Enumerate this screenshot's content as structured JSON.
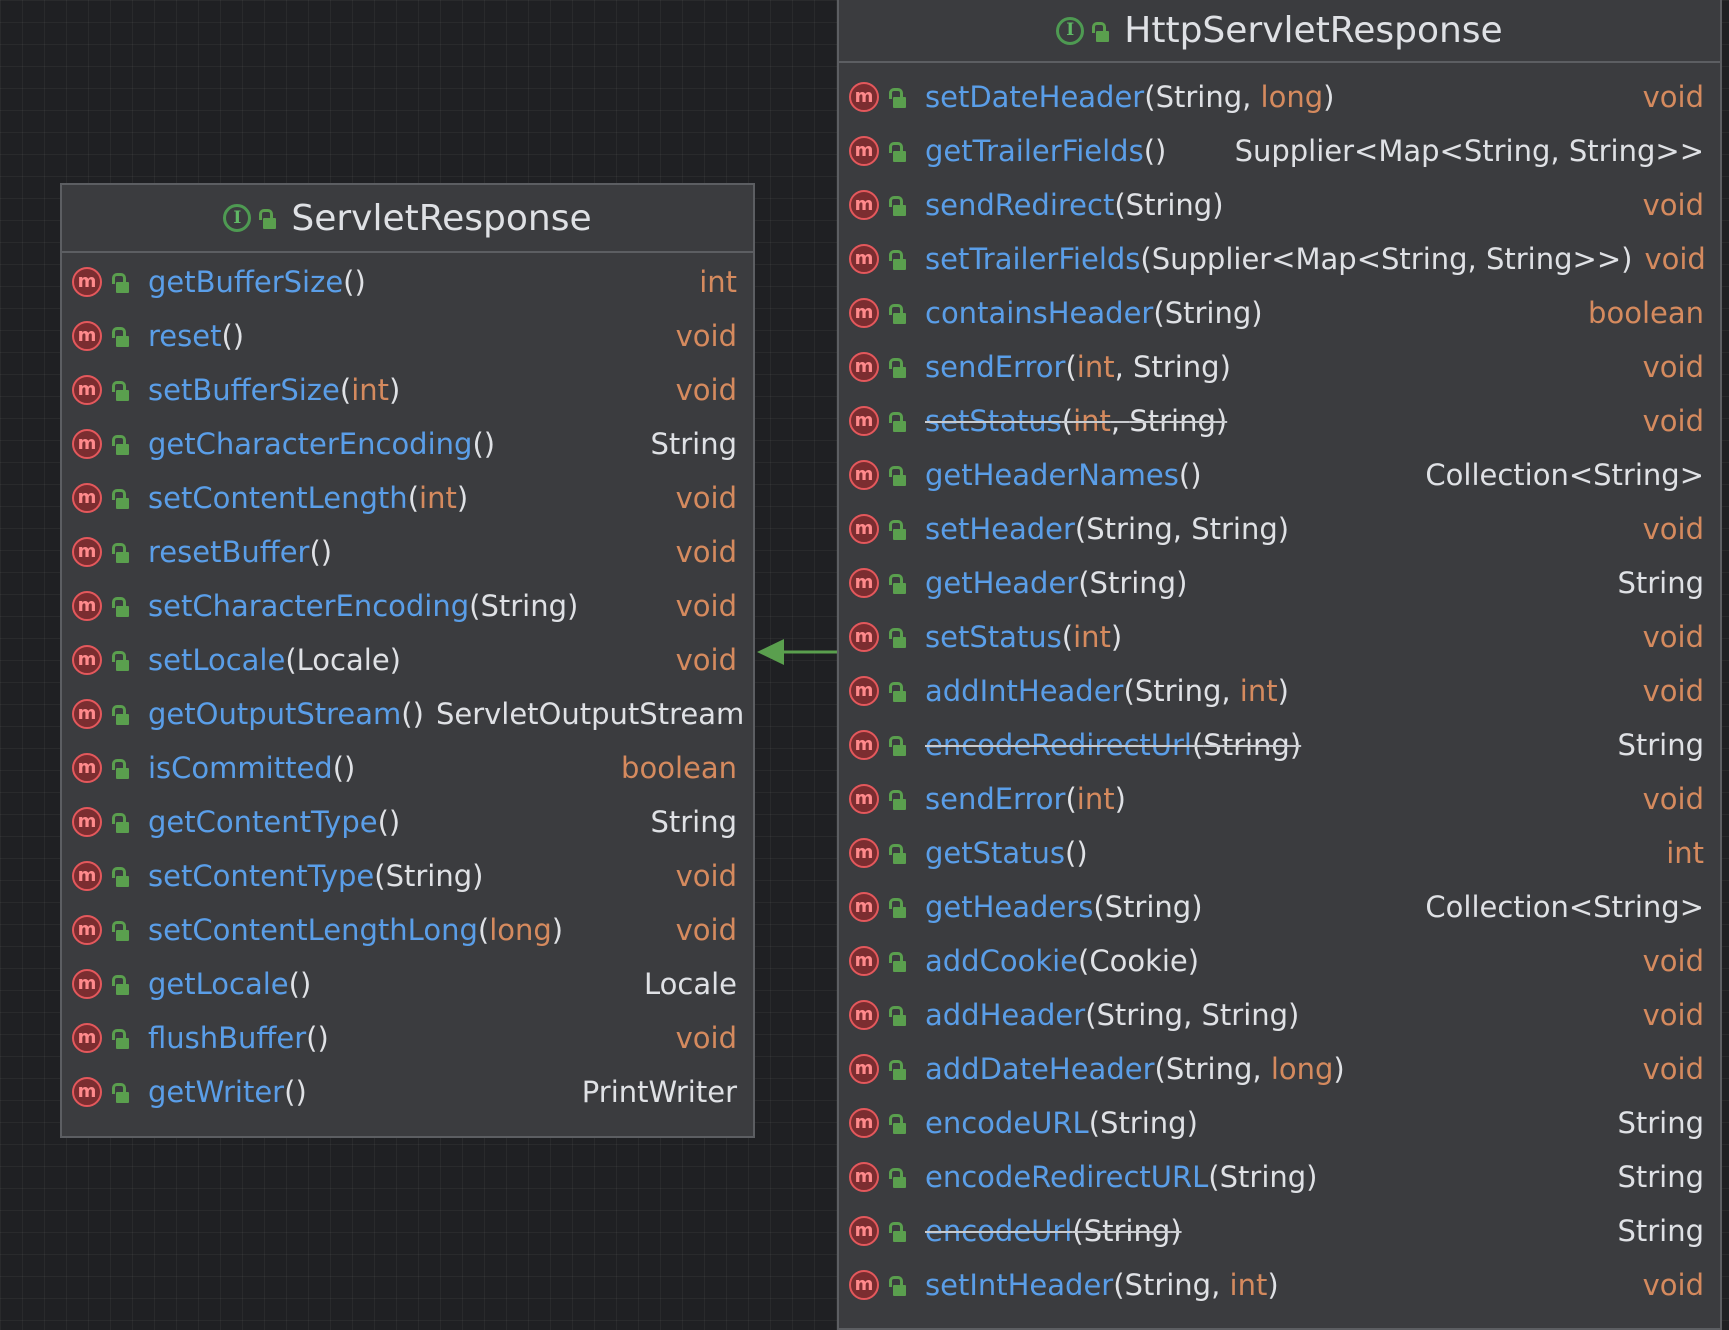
{
  "servlet_response": {
    "name": "ServletResponse",
    "methods": [
      {
        "name": "getBufferSize",
        "open": "(",
        "params": [],
        "close": ")",
        "ret": "int",
        "ret_primitive": true
      },
      {
        "name": "reset",
        "open": "(",
        "params": [],
        "close": ")",
        "ret": "void",
        "ret_primitive": true
      },
      {
        "name": "setBufferSize",
        "open": "(",
        "params": [
          {
            "t": "int",
            "p": true
          }
        ],
        "close": ")",
        "ret": "void",
        "ret_primitive": true
      },
      {
        "name": "getCharacterEncoding",
        "open": "(",
        "params": [],
        "close": ")",
        "ret": "String",
        "ret_primitive": false
      },
      {
        "name": "setContentLength",
        "open": "(",
        "params": [
          {
            "t": "int",
            "p": true
          }
        ],
        "close": ")",
        "ret": "void",
        "ret_primitive": true
      },
      {
        "name": "resetBuffer",
        "open": "(",
        "params": [],
        "close": ")",
        "ret": "void",
        "ret_primitive": true
      },
      {
        "name": "setCharacterEncoding",
        "open": "(",
        "params": [
          {
            "t": "String",
            "p": false
          }
        ],
        "close": ")",
        "ret": "void",
        "ret_primitive": true
      },
      {
        "name": "setLocale",
        "open": "(",
        "params": [
          {
            "t": "Locale",
            "p": false
          }
        ],
        "close": ")",
        "ret": "void",
        "ret_primitive": true
      },
      {
        "name": "getOutputStream",
        "open": "(",
        "params": [],
        "close": ")",
        "ret": "ServletOutputStream",
        "ret_primitive": false
      },
      {
        "name": "isCommitted",
        "open": "(",
        "params": [],
        "close": ")",
        "ret": "boolean",
        "ret_primitive": true
      },
      {
        "name": "getContentType",
        "open": "(",
        "params": [],
        "close": ")",
        "ret": "String",
        "ret_primitive": false
      },
      {
        "name": "setContentType",
        "open": "(",
        "params": [
          {
            "t": "String",
            "p": false
          }
        ],
        "close": ")",
        "ret": "void",
        "ret_primitive": true
      },
      {
        "name": "setContentLengthLong",
        "open": "(",
        "params": [
          {
            "t": "long",
            "p": true
          }
        ],
        "close": ")",
        "ret": "void",
        "ret_primitive": true
      },
      {
        "name": "getLocale",
        "open": "(",
        "params": [],
        "close": ")",
        "ret": "Locale",
        "ret_primitive": false
      },
      {
        "name": "flushBuffer",
        "open": "(",
        "params": [],
        "close": ")",
        "ret": "void",
        "ret_primitive": true
      },
      {
        "name": "getWriter",
        "open": "(",
        "params": [],
        "close": ")",
        "ret": "PrintWriter",
        "ret_primitive": false
      }
    ]
  },
  "http_servlet_response": {
    "name": "HttpServletResponse",
    "methods": [
      {
        "name": "setDateHeader",
        "open": "(",
        "params": [
          {
            "t": "String",
            "p": false
          },
          {
            "t": "long",
            "p": true
          }
        ],
        "close": ")",
        "ret": "void",
        "ret_primitive": true
      },
      {
        "name": "getTrailerFields",
        "open": "(",
        "params": [],
        "close": ")",
        "ret": "Supplier<Map<String, String>>",
        "ret_primitive": false
      },
      {
        "name": "sendRedirect",
        "open": "(",
        "params": [
          {
            "t": "String",
            "p": false
          }
        ],
        "close": ")",
        "ret": "void",
        "ret_primitive": true
      },
      {
        "name": "setTrailerFields",
        "open": "(",
        "params": [
          {
            "t": "Supplier<Map<String, String>>",
            "p": false
          }
        ],
        "close": ")",
        "ret": "void",
        "ret_primitive": true
      },
      {
        "name": "containsHeader",
        "open": "(",
        "params": [
          {
            "t": "String",
            "p": false
          }
        ],
        "close": ")",
        "ret": "boolean",
        "ret_primitive": true
      },
      {
        "name": "sendError",
        "open": "(",
        "params": [
          {
            "t": "int",
            "p": true
          },
          {
            "t": "String",
            "p": false
          }
        ],
        "close": ")",
        "ret": "void",
        "ret_primitive": true
      },
      {
        "name": "setStatus",
        "open": "(",
        "params": [
          {
            "t": "int",
            "p": true
          },
          {
            "t": "String",
            "p": false
          }
        ],
        "close": ")",
        "ret": "void",
        "ret_primitive": true,
        "deprecated": true
      },
      {
        "name": "getHeaderNames",
        "open": "(",
        "params": [],
        "close": ")",
        "ret": "Collection<String>",
        "ret_primitive": false
      },
      {
        "name": "setHeader",
        "open": "(",
        "params": [
          {
            "t": "String",
            "p": false
          },
          {
            "t": "String",
            "p": false
          }
        ],
        "close": ")",
        "ret": "void",
        "ret_primitive": true
      },
      {
        "name": "getHeader",
        "open": "(",
        "params": [
          {
            "t": "String",
            "p": false
          }
        ],
        "close": ")",
        "ret": "String",
        "ret_primitive": false
      },
      {
        "name": "setStatus",
        "open": "(",
        "params": [
          {
            "t": "int",
            "p": true
          }
        ],
        "close": ")",
        "ret": "void",
        "ret_primitive": true
      },
      {
        "name": "addIntHeader",
        "open": "(",
        "params": [
          {
            "t": "String",
            "p": false
          },
          {
            "t": "int",
            "p": true
          }
        ],
        "close": ")",
        "ret": "void",
        "ret_primitive": true
      },
      {
        "name": "encodeRedirectUrl",
        "open": "(",
        "params": [
          {
            "t": "String",
            "p": false
          }
        ],
        "close": ")",
        "ret": "String",
        "ret_primitive": false,
        "deprecated": true
      },
      {
        "name": "sendError",
        "open": "(",
        "params": [
          {
            "t": "int",
            "p": true
          }
        ],
        "close": ")",
        "ret": "void",
        "ret_primitive": true
      },
      {
        "name": "getStatus",
        "open": "(",
        "params": [],
        "close": ")",
        "ret": "int",
        "ret_primitive": true
      },
      {
        "name": "getHeaders",
        "open": "(",
        "params": [
          {
            "t": "String",
            "p": false
          }
        ],
        "close": ")",
        "ret": "Collection<String>",
        "ret_primitive": false
      },
      {
        "name": "addCookie",
        "open": "(",
        "params": [
          {
            "t": "Cookie",
            "p": false
          }
        ],
        "close": ")",
        "ret": "void",
        "ret_primitive": true
      },
      {
        "name": "addHeader",
        "open": "(",
        "params": [
          {
            "t": "String",
            "p": false
          },
          {
            "t": "String",
            "p": false
          }
        ],
        "close": ")",
        "ret": "void",
        "ret_primitive": true
      },
      {
        "name": "addDateHeader",
        "open": "(",
        "params": [
          {
            "t": "String",
            "p": false
          },
          {
            "t": "long",
            "p": true
          }
        ],
        "close": ")",
        "ret": "void",
        "ret_primitive": true
      },
      {
        "name": "encodeURL",
        "open": "(",
        "params": [
          {
            "t": "String",
            "p": false
          }
        ],
        "close": ")",
        "ret": "String",
        "ret_primitive": false
      },
      {
        "name": "encodeRedirectURL",
        "open": "(",
        "params": [
          {
            "t": "String",
            "p": false
          }
        ],
        "close": ")",
        "ret": "String",
        "ret_primitive": false
      },
      {
        "name": "encodeUrl",
        "open": "(",
        "params": [
          {
            "t": "String",
            "p": false
          }
        ],
        "close": ")",
        "ret": "String",
        "ret_primitive": false,
        "deprecated": true
      },
      {
        "name": "setIntHeader",
        "open": "(",
        "params": [
          {
            "t": "String",
            "p": false
          },
          {
            "t": "int",
            "p": true
          }
        ],
        "close": ")",
        "ret": "void",
        "ret_primitive": true
      }
    ]
  },
  "icons": {
    "interface_letter": "I",
    "method_letter": "m"
  },
  "colors": {
    "method_name": "#5a9ee8",
    "primitive_type": "#d58a5e",
    "reference_type": "#dfe1e5",
    "inheritance_arrow": "#5a9f4e"
  }
}
